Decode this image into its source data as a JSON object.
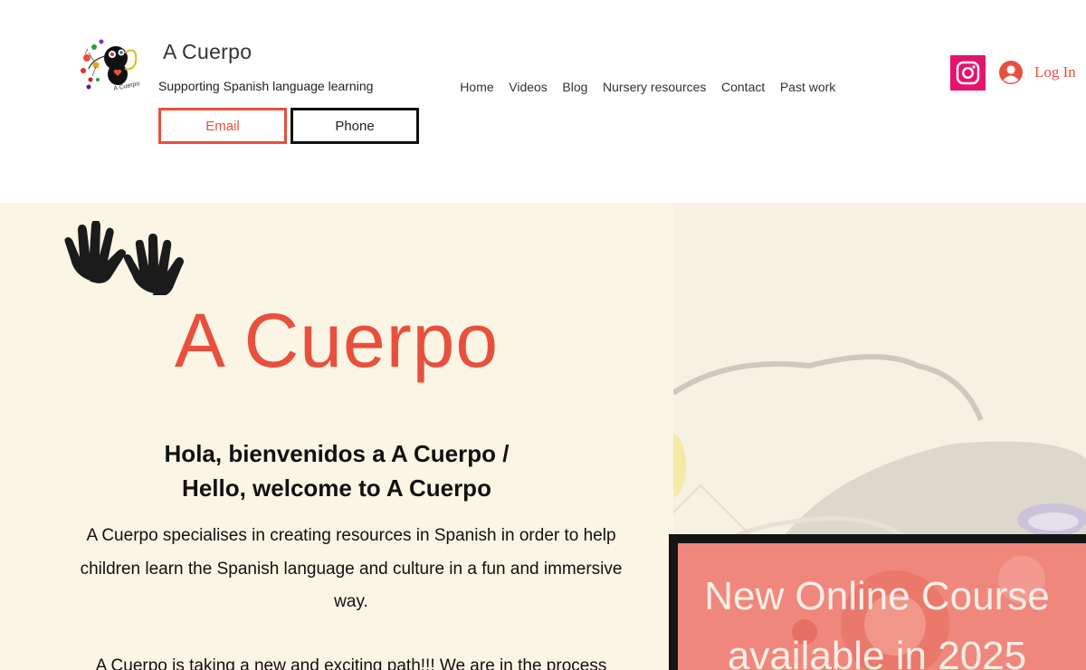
{
  "header": {
    "site_title": "A Cuerpo",
    "logo_text": "A Cuerpo",
    "tagline": "Supporting Spanish language learning",
    "email_button": "Email",
    "phone_button": "Phone",
    "nav": [
      {
        "label": "Home"
      },
      {
        "label": "Videos"
      },
      {
        "label": "Blog"
      },
      {
        "label": "Nursery resources"
      },
      {
        "label": "Contact"
      },
      {
        "label": "Past work"
      }
    ],
    "instagram_icon": "instagram-icon",
    "login_label": "Log In"
  },
  "hero": {
    "title": "A Cuerpo",
    "welcome_line1": "Hola, bienvenidos a A Cuerpo /",
    "welcome_line2": "Hello, welcome to A Cuerpo",
    "intro": "A Cuerpo specialises in creating resources in Spanish in order to help children learn the Spanish language and culture in a fun and immersive way.",
    "intro2": "A Cuerpo is taking a new and exciting path!!! We are in the process",
    "promo_line1": "New Online Course",
    "promo_line2": "available in 2025"
  },
  "colors": {
    "accent": "#e8503d",
    "instagram": "#e4146e",
    "hero_bg": "#faf5e4",
    "promo_bg": "#f0877c"
  }
}
